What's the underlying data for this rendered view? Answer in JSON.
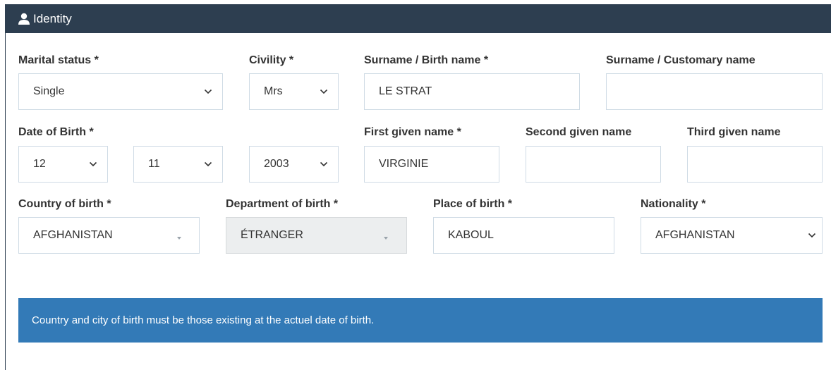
{
  "header": {
    "title": "Identity",
    "icon": "user-icon"
  },
  "labels": {
    "marital_status": "Marital status *",
    "civility": "Civility *",
    "surname_birth": "Surname / Birth name *",
    "surname_customary": "Surname / Customary name",
    "date_of_birth": "Date of Birth *",
    "first_given": "First given name *",
    "second_given": "Second given name",
    "third_given": "Third given name",
    "country_of_birth": "Country of birth *",
    "department_of_birth": "Department of birth *",
    "place_of_birth": "Place of birth *",
    "nationality": "Nationality *"
  },
  "values": {
    "marital_status": "Single",
    "civility": "Mrs",
    "surname_birth": "LE STRAT",
    "surname_customary": "",
    "birth_day": "12",
    "birth_month": "11",
    "birth_year": "2003",
    "first_given": "VIRGINIE",
    "second_given": "",
    "third_given": "",
    "country_of_birth": "AFGHANISTAN",
    "department_of_birth": "ÉTRANGER",
    "place_of_birth": "KABOUL",
    "nationality": "AFGHANISTAN"
  },
  "notice": "Country and city of birth must be those existing at the actuel date of birth.",
  "colors": {
    "header_bg": "#2d3e50",
    "alert_bg": "#337ab7",
    "field_border": "#cfdbe5",
    "disabled_bg": "#eceeef"
  }
}
